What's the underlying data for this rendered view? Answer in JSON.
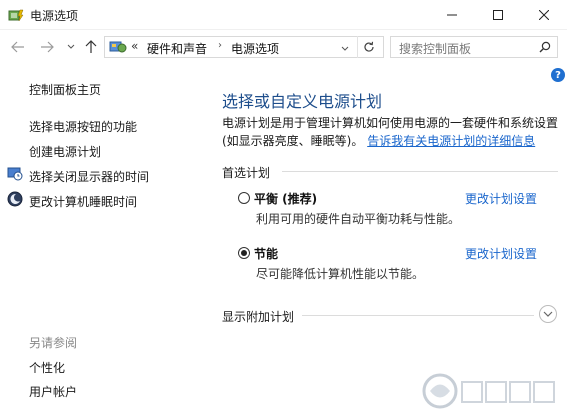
{
  "window": {
    "title": "电源选项"
  },
  "address_bar": {
    "overflow": "«",
    "crumbs": [
      "硬件和声音",
      "电源选项"
    ]
  },
  "search": {
    "placeholder": "搜索控制面板"
  },
  "sidebar": {
    "home": "控制面板主页",
    "links": [
      "选择电源按钮的功能",
      "创建电源计划",
      "选择关闭显示器的时间",
      "更改计算机睡眠时间"
    ],
    "see_also_title": "另请参阅",
    "see_also": [
      "个性化",
      "用户帐户"
    ]
  },
  "main": {
    "heading": "选择或自定义电源计划",
    "description": "电源计划是用于管理计算机如何使用电源的一套硬件和系统设置(如显示器亮度、睡眠等)。",
    "description_link": "告诉我有关电源计划的详细信息",
    "preferred_label": "首选计划",
    "plans": [
      {
        "name": "平衡 (推荐)",
        "desc": "利用可用的硬件自动平衡功耗与性能。",
        "link": "更改计划设置",
        "selected": false
      },
      {
        "name": "节能",
        "desc": "尽可能降低计算机性能以节能。",
        "link": "更改计划设置",
        "selected": true
      }
    ],
    "more_plans_label": "显示附加计划"
  },
  "help": {
    "label": "?"
  },
  "colors": {
    "heading": "#1e4e8c",
    "link": "#1a66cc",
    "help_bg": "#1f6fd0"
  }
}
